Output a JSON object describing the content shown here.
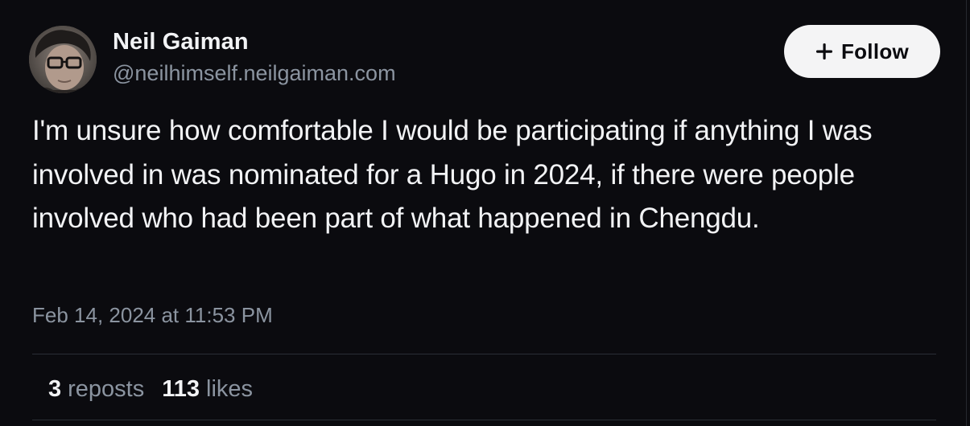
{
  "author": {
    "display_name": "Neil Gaiman",
    "handle": "@neilhimself.neilgaiman.com",
    "avatar_icon": "author-photo"
  },
  "follow_button": {
    "label": "Follow",
    "icon": "plus-icon"
  },
  "post": {
    "text": "I'm unsure how comfortable I would be participating if anything I was involved in was nominated for a Hugo in 2024, if there were people involved who had been part of what happened in Chengdu.",
    "timestamp": "Feb 14, 2024 at 11:53 PM"
  },
  "stats": {
    "reposts_count": "3",
    "reposts_label": "reposts",
    "likes_count": "113",
    "likes_label": "likes"
  },
  "colors": {
    "background": "#0b0b0f",
    "text_primary": "#f2f3f5",
    "text_secondary": "#8b94a0",
    "button_bg": "#f4f4f5"
  }
}
